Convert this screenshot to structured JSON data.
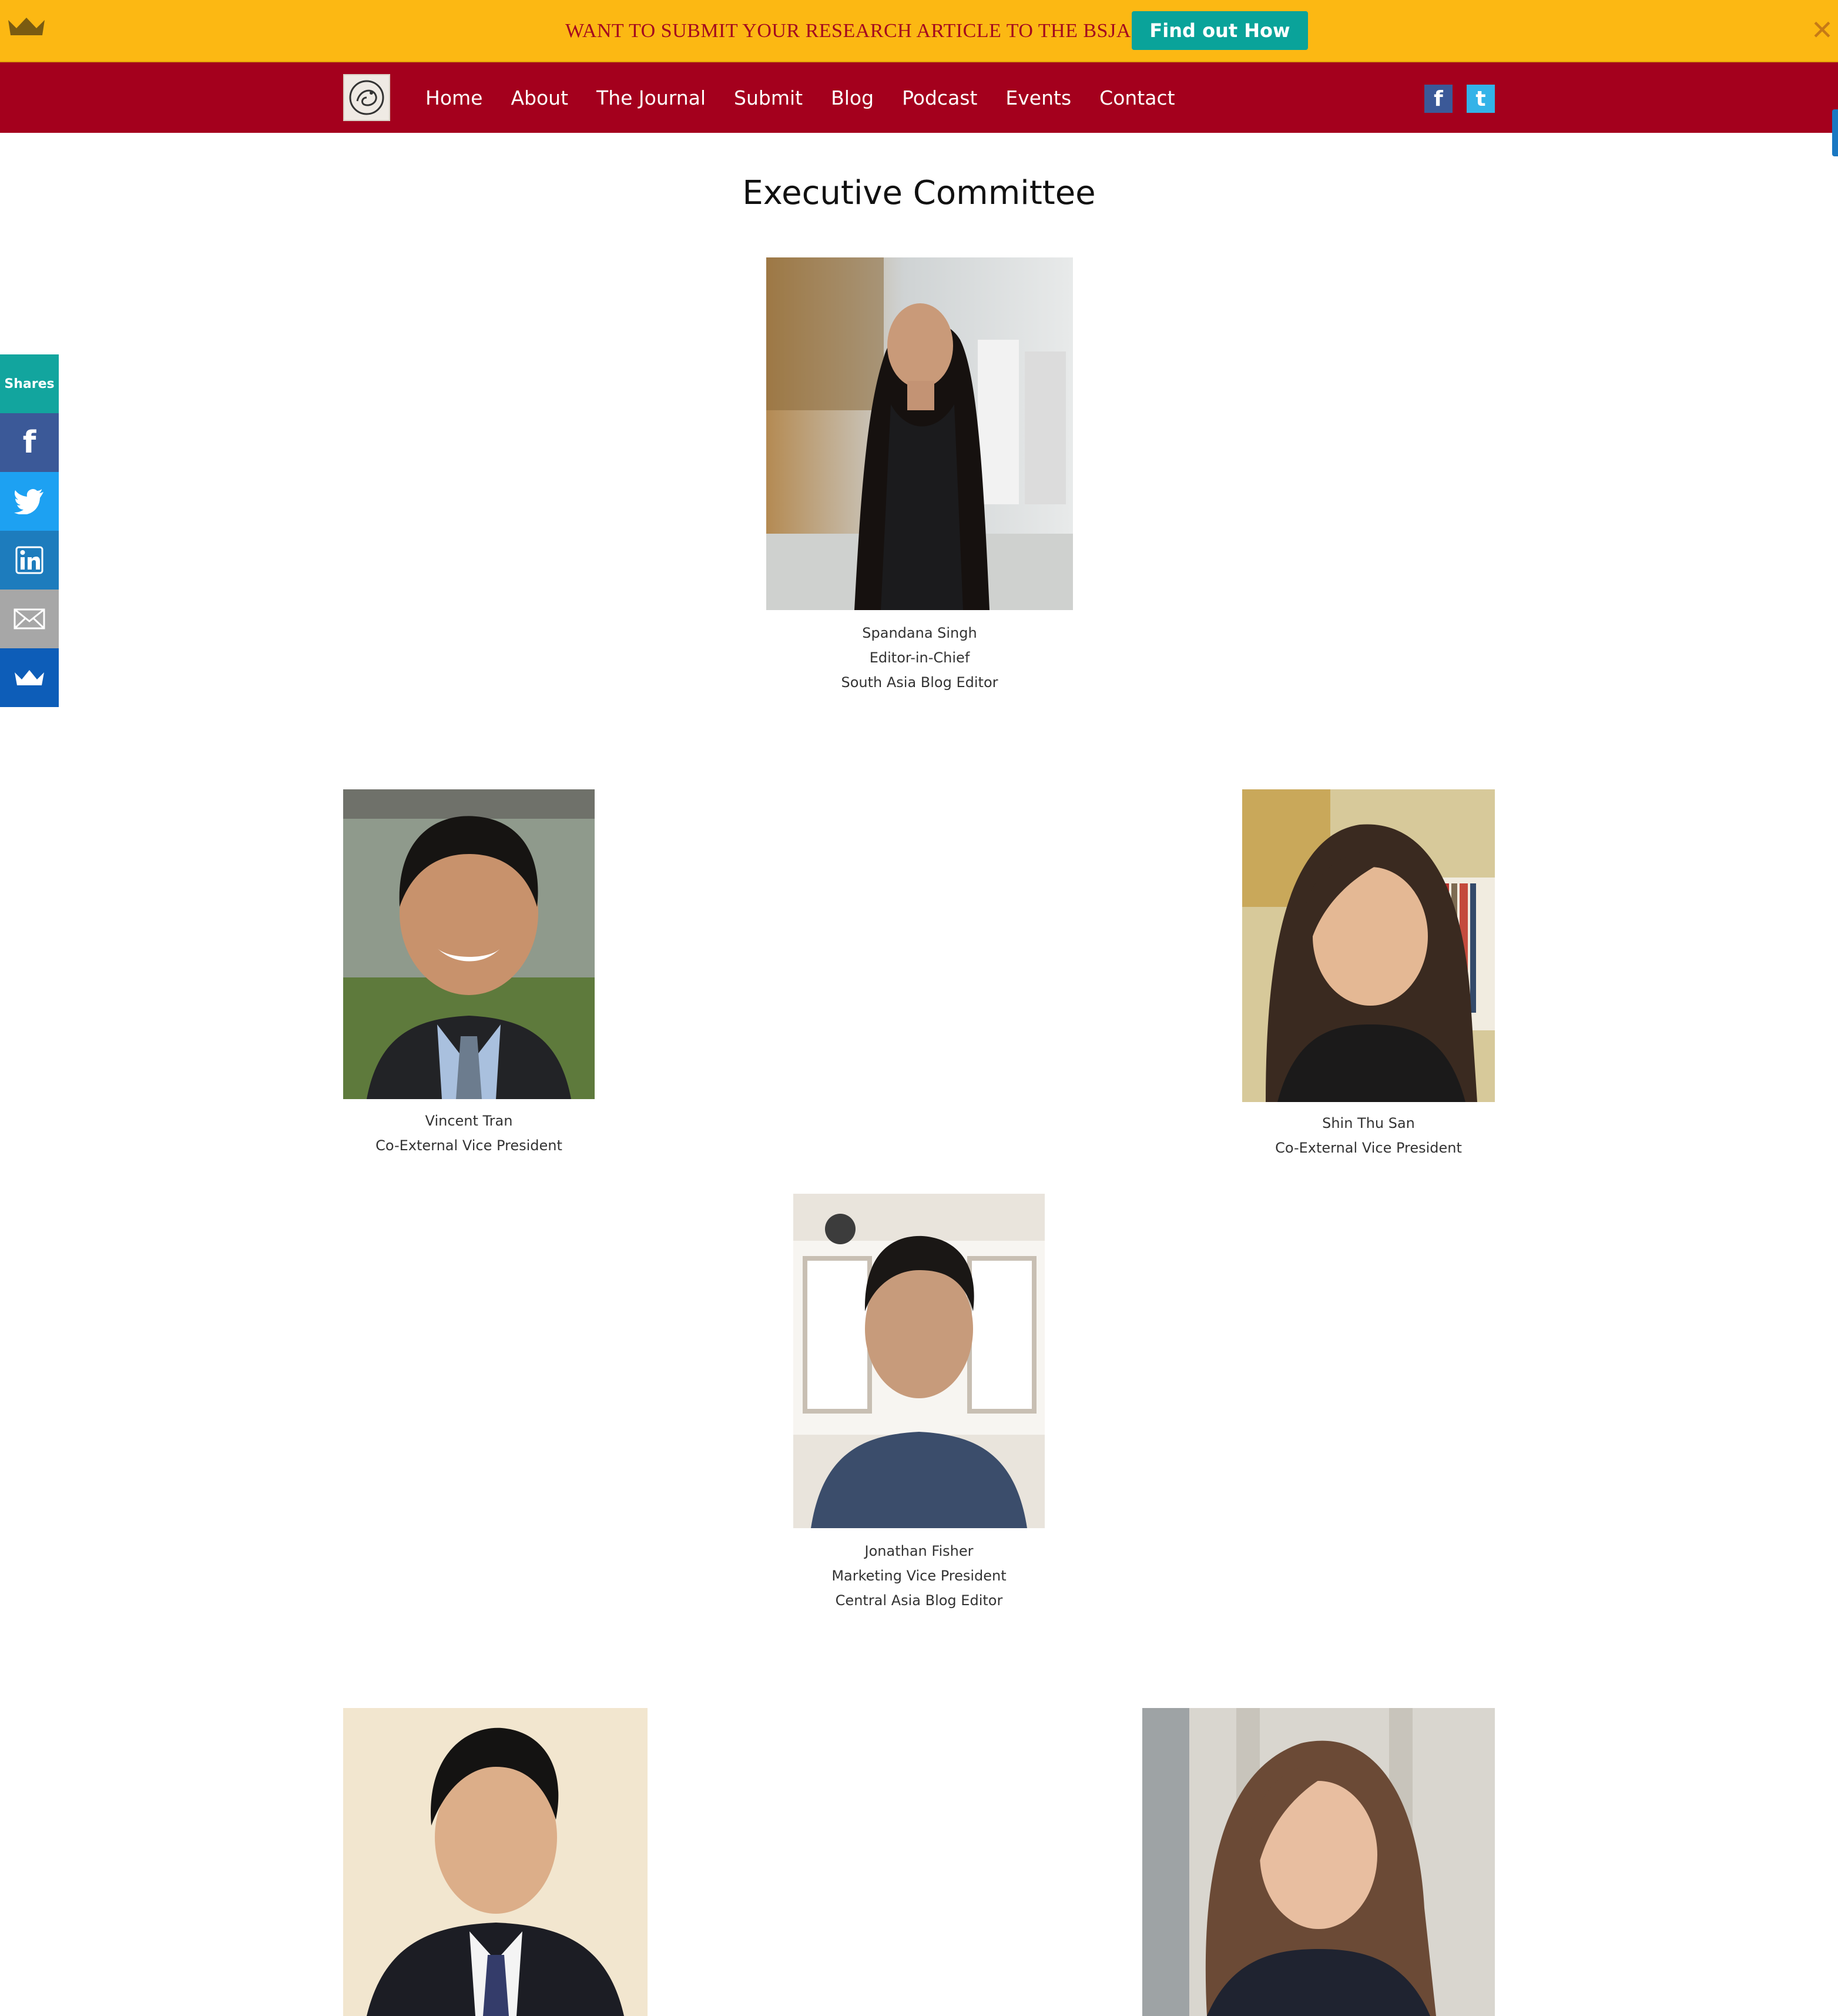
{
  "promo": {
    "message": "WANT TO SUBMIT YOUR RESEARCH ARTICLE TO THE BSJAS?",
    "cta_label": "Find out How",
    "close_glyph": "✕",
    "bg_color": "#fcb813",
    "cta_color": "#0aa39a",
    "text_color": "#a3081f"
  },
  "nav": {
    "items": [
      "Home",
      "About",
      "The Journal",
      "Submit",
      "Blog",
      "Podcast",
      "Events",
      "Contact"
    ],
    "social": {
      "facebook": "f",
      "twitter": "t"
    },
    "bg_color": "#a4001d"
  },
  "page": {
    "title": "Executive Committee"
  },
  "share_bar": {
    "label": "Shares",
    "icons": [
      "facebook-icon",
      "twitter-icon",
      "linkedin-icon",
      "email-icon",
      "sumo-crown-icon"
    ]
  },
  "members": [
    {
      "name": "Spandana Singh",
      "roles": [
        "Editor-in-Chief",
        "South Asia Blog Editor"
      ]
    },
    {
      "name": "Vincent Tran",
      "roles": [
        "Co-External Vice President"
      ]
    },
    {
      "name": "Shin Thu San",
      "roles": [
        "Co-External Vice President"
      ]
    },
    {
      "name": "Jonathan Fisher",
      "roles": [
        "Marketing Vice President",
        "Central Asia Blog Editor"
      ]
    }
  ]
}
